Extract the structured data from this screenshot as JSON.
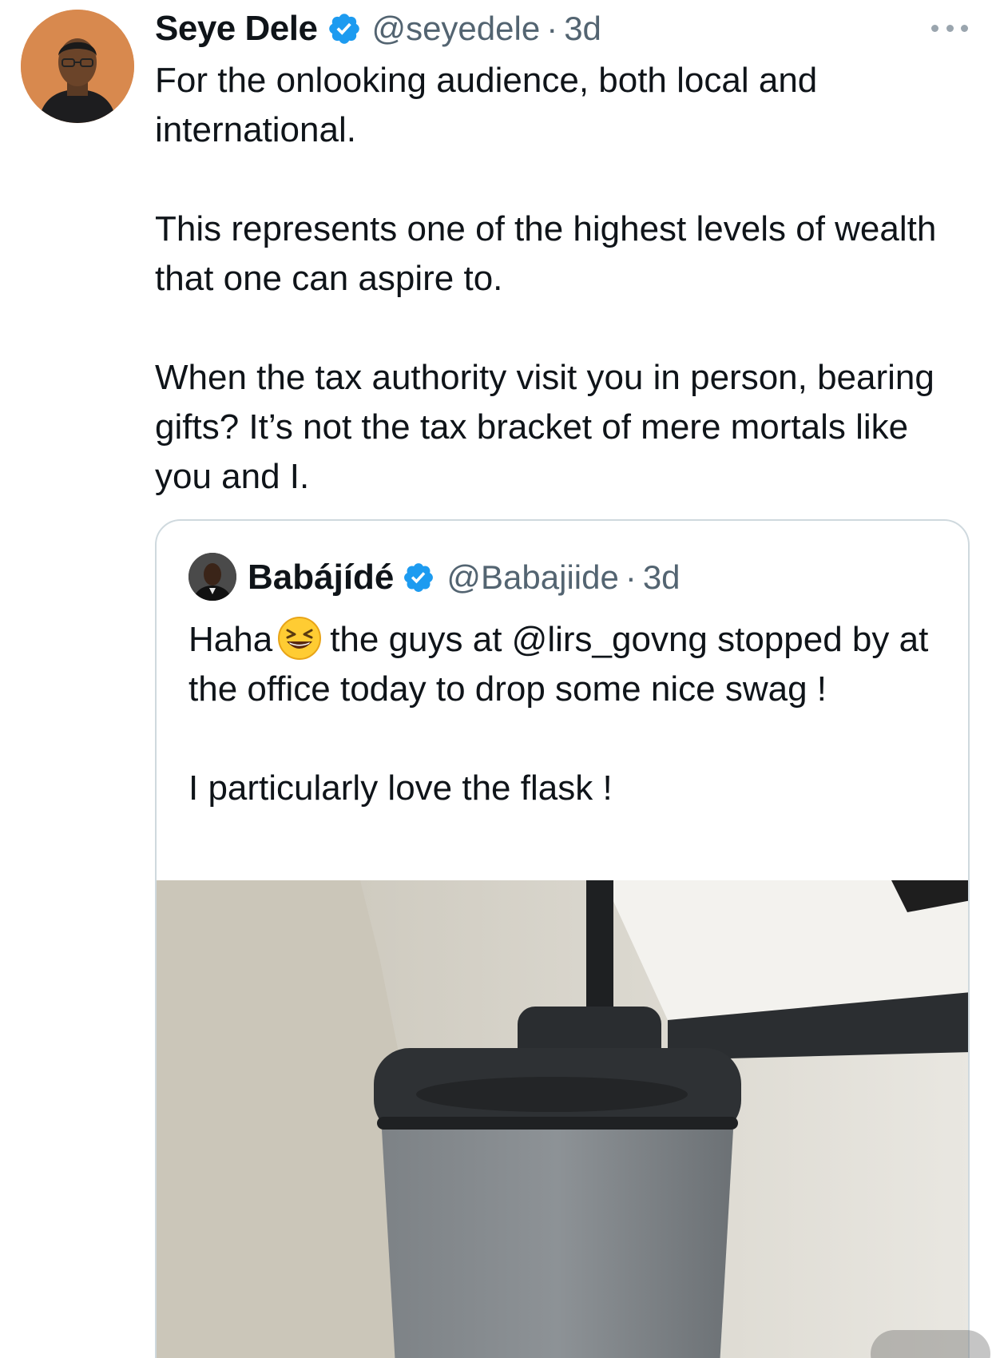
{
  "tweet": {
    "author_name": "Seye Dele",
    "author_handle": "@seyedele",
    "separator": "·",
    "timestamp": "3d",
    "paragraphs": [
      "For the onlooking audience, both local and international.",
      "This represents one of the highest levels of wealth that one can aspire to.",
      "When the tax authority visit you in person, bearing gifts? It’s not the tax bracket of mere mortals like you and I."
    ]
  },
  "quoted_tweet": {
    "author_name": "Babájídé",
    "author_handle": "@Babajiide",
    "separator": "·",
    "timestamp": "3d",
    "line1_before_emoji": "Haha",
    "line1_after_emoji": "the guys at @lirs_govng stopped by at the office today to drop some nice swag !",
    "line2": "I particularly love the flask !",
    "media_icon": "photo-of-flask"
  },
  "colors": {
    "verified": "#1d9bf0",
    "secondary_text": "#536471",
    "border": "#cfd9de"
  }
}
